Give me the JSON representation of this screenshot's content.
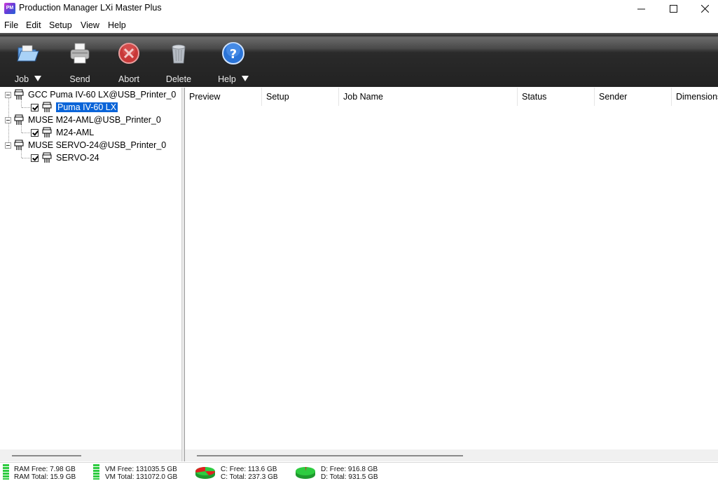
{
  "window": {
    "title": "Production Manager LXi Master Plus",
    "icon_text": "PM"
  },
  "menu": [
    "File",
    "Edit",
    "Setup",
    "View",
    "Help"
  ],
  "toolbar": {
    "job": "Job",
    "send": "Send",
    "abort": "Abort",
    "delete": "Delete",
    "help": "Help"
  },
  "tree": {
    "printers": [
      {
        "name": "GCC Puma IV-60 LX@USB_Printer_0",
        "queue": "Puma IV-60 LX",
        "checked": true,
        "selected": true
      },
      {
        "name": "MUSE M24-AML@USB_Printer_0",
        "queue": "M24-AML",
        "checked": true,
        "selected": false
      },
      {
        "name": "MUSE SERVO-24@USB_Printer_0",
        "queue": "SERVO-24",
        "checked": true,
        "selected": false
      }
    ]
  },
  "job_list": {
    "columns": [
      "Preview",
      "Setup",
      "Job Name",
      "Status",
      "Sender",
      "Dimensions"
    ]
  },
  "status": {
    "ram_free": "RAM Free: 7.98 GB",
    "ram_total": "RAM Total: 15.9 GB",
    "vm_free": "VM Free: 131035.5 GB",
    "vm_total": "VM Total: 131072.0 GB",
    "c_free": "C: Free: 113.6 GB",
    "c_total": "C: Total: 237.3 GB",
    "d_free": "D: Free: 916.8 GB",
    "d_total": "D: Total: 931.5 GB",
    "colors": {
      "free": "#2ecc40",
      "used": "#e02020",
      "bar": "#2ecc40"
    }
  }
}
